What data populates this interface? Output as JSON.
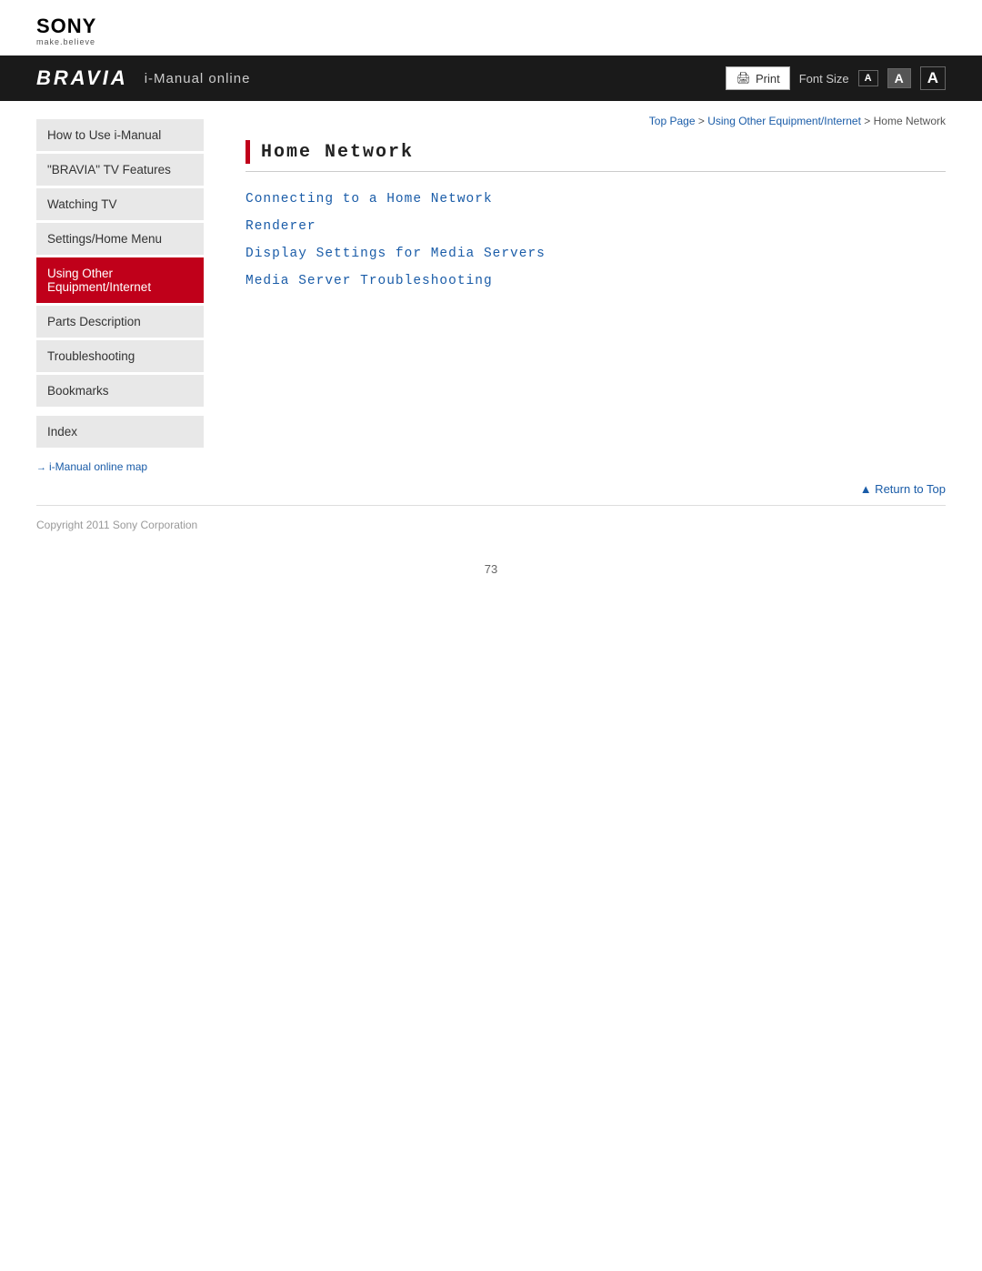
{
  "logo": {
    "brand": "SONY",
    "tagline": "make.believe"
  },
  "topbar": {
    "bravia": "BRAVIA",
    "title": "i-Manual online",
    "print_label": "Print",
    "font_size_label": "Font Size",
    "font_small": "A",
    "font_medium": "A",
    "font_large": "A"
  },
  "breadcrumb": {
    "top_page": "Top Page",
    "separator1": " > ",
    "section": "Using Other Equipment/Internet",
    "separator2": " > ",
    "current": "Home Network"
  },
  "sidebar": {
    "items": [
      {
        "id": "how-to-use",
        "label": "How to Use i-Manual",
        "active": false
      },
      {
        "id": "bravia-features",
        "label": "\"BRAVIA\" TV Features",
        "active": false
      },
      {
        "id": "watching-tv",
        "label": "Watching TV",
        "active": false
      },
      {
        "id": "settings-home-menu",
        "label": "Settings/Home Menu",
        "active": false
      },
      {
        "id": "using-other",
        "label": "Using Other Equipment/Internet",
        "active": true
      },
      {
        "id": "parts-description",
        "label": "Parts Description",
        "active": false
      },
      {
        "id": "troubleshooting",
        "label": "Troubleshooting",
        "active": false
      },
      {
        "id": "bookmarks",
        "label": "Bookmarks",
        "active": false
      }
    ],
    "index_label": "Index",
    "map_link": "i-Manual online map"
  },
  "content": {
    "page_title": "Home Network",
    "links": [
      {
        "id": "connecting",
        "label": "Connecting to a Home Network"
      },
      {
        "id": "renderer",
        "label": "Renderer"
      },
      {
        "id": "display-settings",
        "label": "Display Settings for Media Servers"
      },
      {
        "id": "troubleshooting",
        "label": "Media Server Troubleshooting"
      }
    ]
  },
  "return_top": "▲ Return to Top",
  "footer": {
    "copyright": "Copyright 2011 Sony Corporation"
  },
  "page_number": "73"
}
